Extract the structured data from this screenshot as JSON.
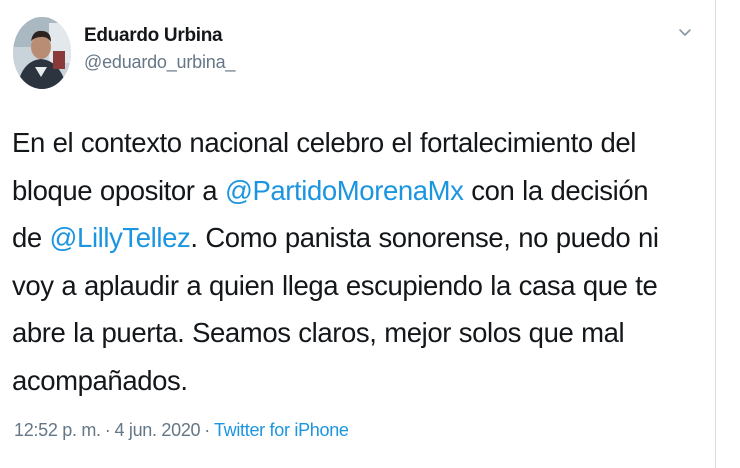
{
  "author": {
    "display_name": "Eduardo Urbina",
    "handle": "@eduardo_urbina_"
  },
  "tweet": {
    "line1": "En el contexto nacional celebro el fortalecimiento del",
    "line2_a": "bloque opositor a ",
    "mention1": "@PartidoMorenaMx",
    "line2_b": " con la decisión",
    "line3_a": "de ",
    "mention2": "@LillyTellez",
    "line3_b": ". Como panista sonorense, no puedo ni",
    "line4": "voy a aplaudir a quien llega escupiendo la casa que te",
    "line5": "abre la puerta. Seamos claros, mejor solos que mal",
    "line6": "acompañados."
  },
  "meta": {
    "time": "12:52 p. m.",
    "separator1": "·",
    "date": "4 jun. 2020",
    "separator2": "·",
    "source": "Twitter for iPhone"
  },
  "icons": {
    "menu": "chevron-down-icon"
  },
  "colors": {
    "link": "#1b95e0",
    "secondary_text": "#657786",
    "primary_text": "#14171a"
  }
}
